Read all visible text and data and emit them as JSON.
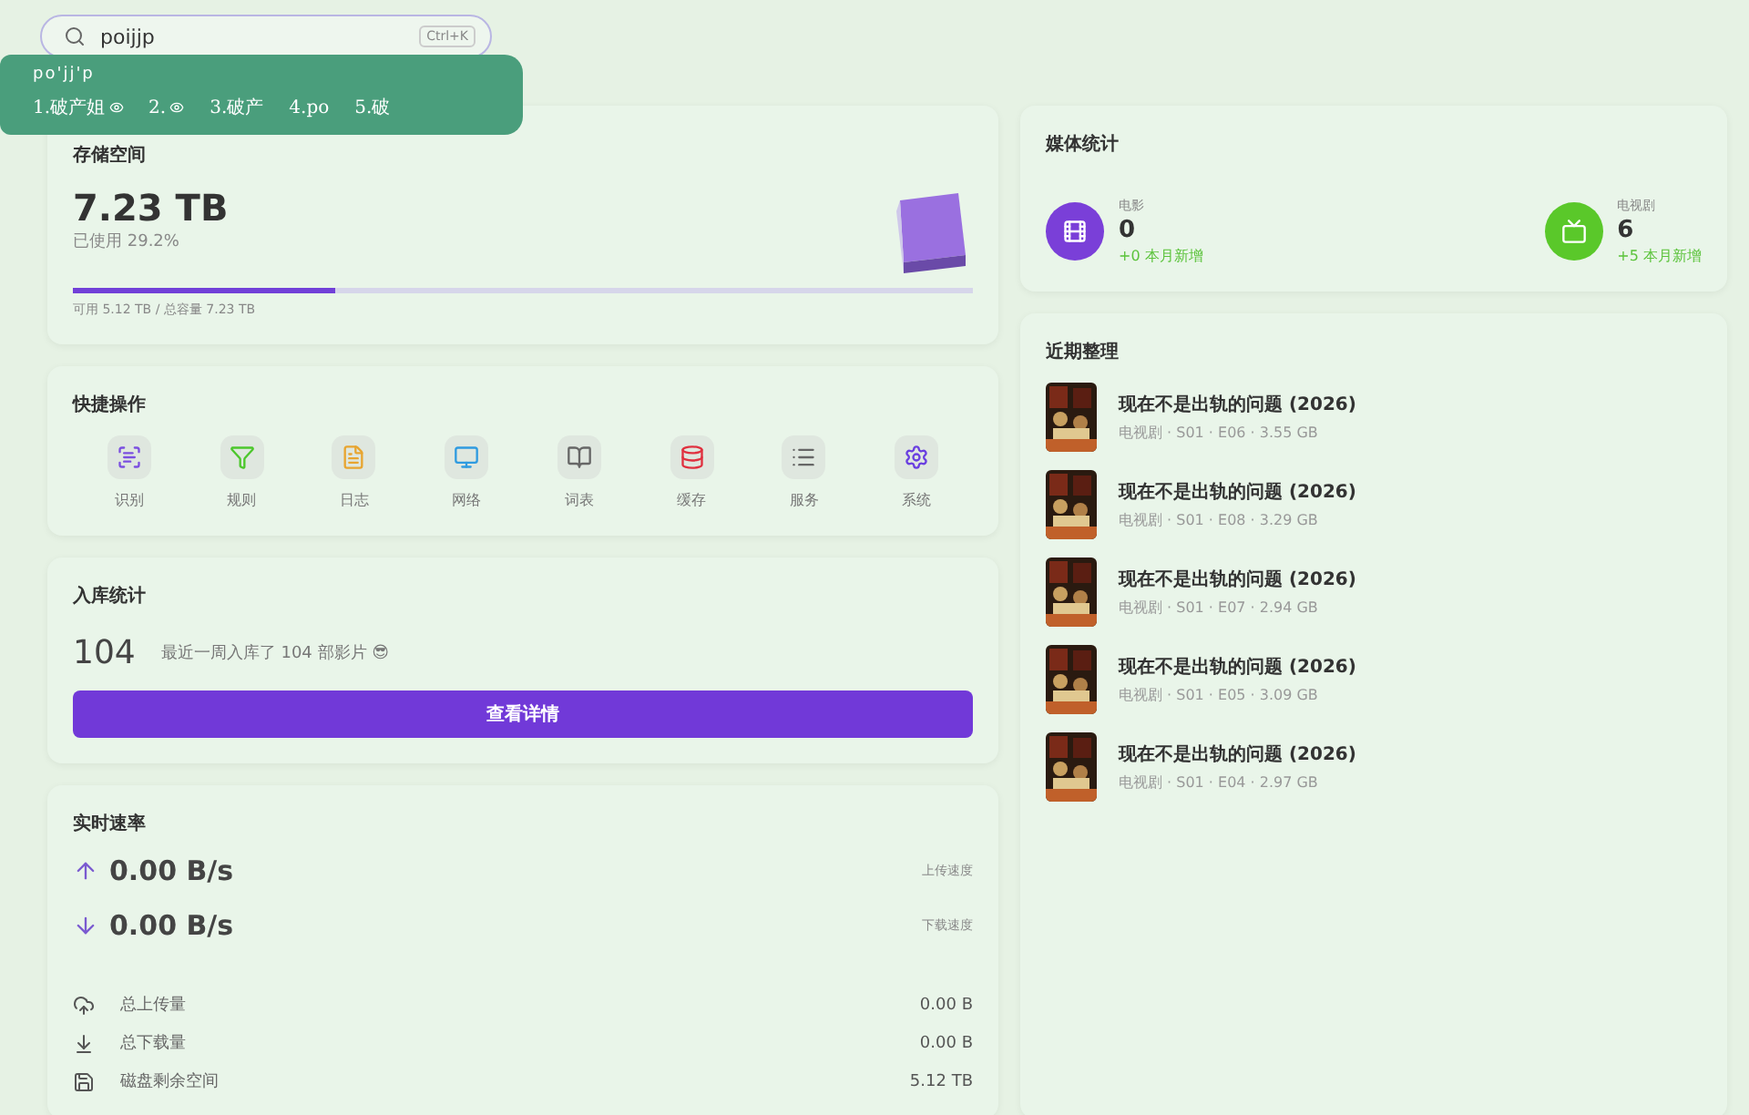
{
  "search": {
    "value": "poijjp",
    "shortcut": "Ctrl+K"
  },
  "ime": {
    "composition": "po'jj'p",
    "candidates": [
      {
        "index": "1.",
        "text": "破产姐",
        "icon": true
      },
      {
        "index": "2.",
        "icon": true
      },
      {
        "index": "3.",
        "text": "破产",
        "icon": false
      },
      {
        "index": "4.",
        "text": "po",
        "icon": false
      },
      {
        "index": "5.",
        "text": "破",
        "icon": false
      }
    ]
  },
  "storage": {
    "title": "存储空间",
    "total": "7.23 TB",
    "used": "已使用 29.2%",
    "level": 0.292,
    "detail": "可用 5.12 TB / 总容量 7.23 TB"
  },
  "quick_actions": {
    "title": "快捷操作",
    "items": [
      {
        "label": "识别",
        "kind": "scan",
        "color": "#7b4fe0"
      },
      {
        "label": "规则",
        "kind": "filter",
        "color": "#4cc72c"
      },
      {
        "label": "日志",
        "kind": "file",
        "color": "#e8a530"
      },
      {
        "label": "网络",
        "kind": "monitor",
        "color": "#2f9be0"
      },
      {
        "label": "词表",
        "kind": "book",
        "color": "#666666"
      },
      {
        "label": "缓存",
        "kind": "database",
        "color": "#e0303f"
      },
      {
        "label": "服务",
        "kind": "list",
        "color": "#666666"
      },
      {
        "label": "系统",
        "kind": "gear",
        "color": "#6a3fe0"
      }
    ]
  },
  "imports": {
    "title": "入库统计",
    "count": "104",
    "text": "最近一周入库了 104 部影片 😎",
    "button": "查看详情"
  },
  "speed": {
    "title": "实时速率",
    "rates": [
      {
        "kind": "up",
        "value": "0.00 B/s",
        "label": "上传速度"
      },
      {
        "kind": "down",
        "value": "0.00 B/s",
        "label": "下载速度"
      }
    ],
    "totals": [
      {
        "kind": "upload",
        "label": "总上传量",
        "value": "0.00 B"
      },
      {
        "kind": "download",
        "label": "总下载量",
        "value": "0.00 B"
      },
      {
        "kind": "disk",
        "label": "磁盘剩余空间",
        "value": "5.12 TB"
      }
    ]
  },
  "media": {
    "title": "媒体统计",
    "items": [
      {
        "kind": "movie",
        "label": "电影",
        "count": "0",
        "delta": "+0 本月新增"
      },
      {
        "kind": "tv",
        "label": "电视剧",
        "count": "6",
        "delta": "+5 本月新增"
      }
    ]
  },
  "recent": {
    "title": "近期整理",
    "items": [
      {
        "title": "现在不是出轨的问题 (2026)",
        "meta": "电视剧 · S01 · E06 · 3.55 GB"
      },
      {
        "title": "现在不是出轨的问题 (2026)",
        "meta": "电视剧 · S01 · E08 · 3.29 GB"
      },
      {
        "title": "现在不是出轨的问题 (2026)",
        "meta": "电视剧 · S01 · E07 · 2.94 GB"
      },
      {
        "title": "现在不是出轨的问题 (2026)",
        "meta": "电视剧 · S01 · E05 · 3.09 GB"
      },
      {
        "title": "现在不是出轨的问题 (2026)",
        "meta": "电视剧 · S01 · E04 · 2.97 GB"
      }
    ]
  }
}
